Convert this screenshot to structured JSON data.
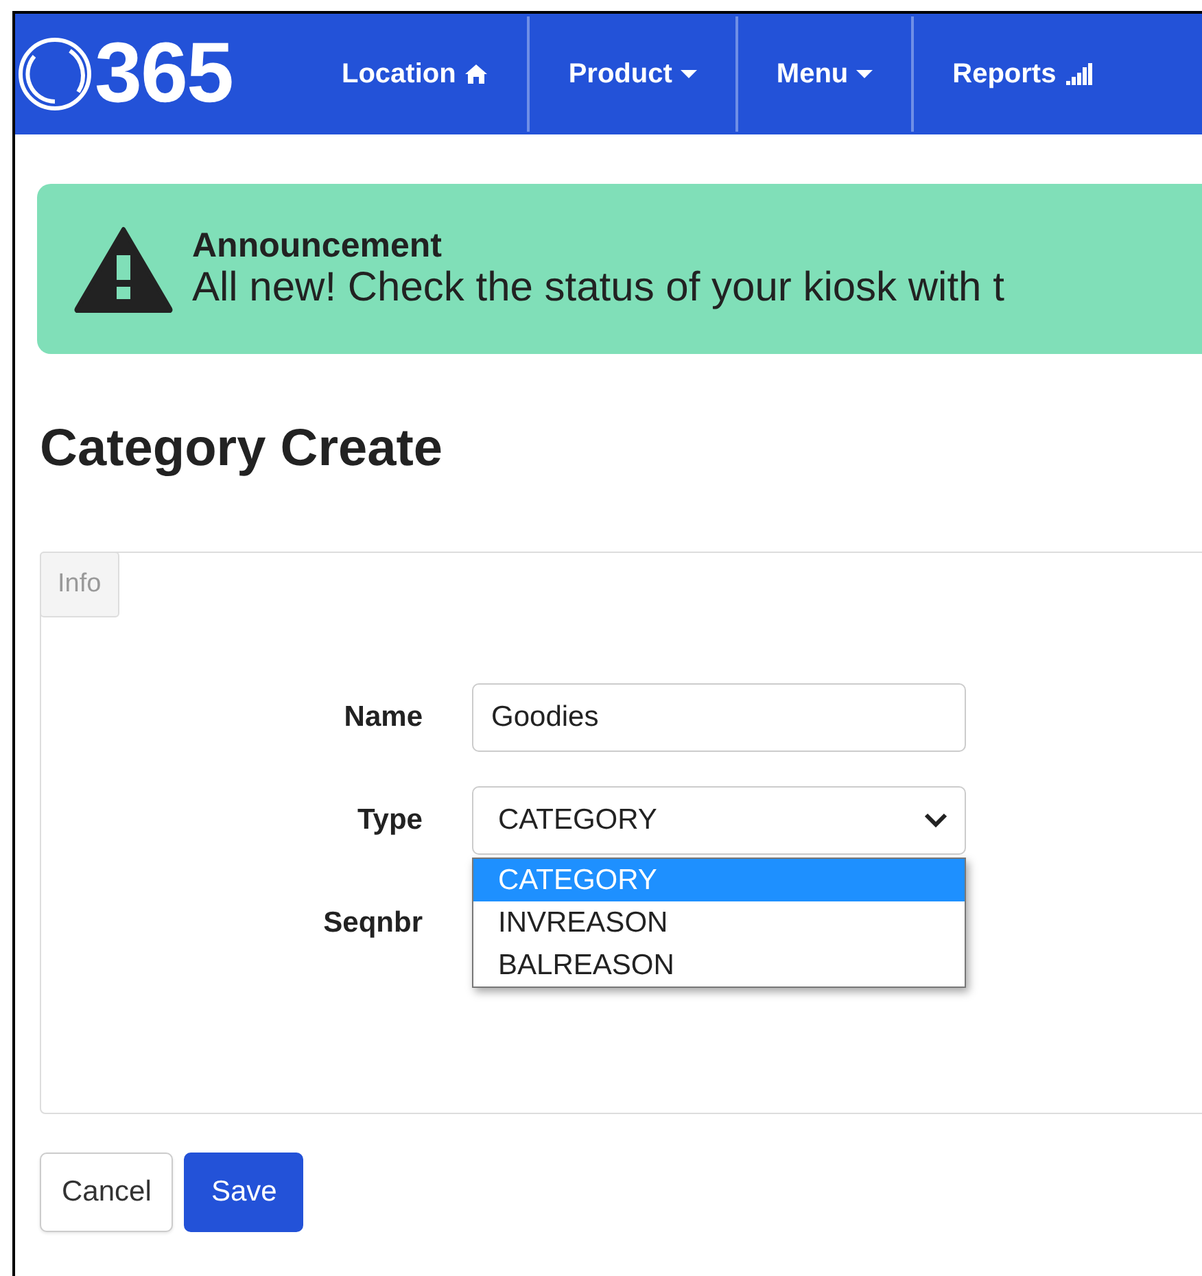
{
  "navbar": {
    "brand": "365",
    "items": [
      {
        "label": "Location",
        "kind": "home"
      },
      {
        "label": "Product",
        "kind": "dropdown"
      },
      {
        "label": "Menu",
        "kind": "dropdown"
      },
      {
        "label": "Reports",
        "kind": "signal"
      }
    ]
  },
  "announcement": {
    "title": "Announcement",
    "text": "All new! Check the status of your kiosk with t"
  },
  "heading": "Category Create",
  "tabs": [
    {
      "label": "Info",
      "selected": false
    }
  ],
  "form": {
    "fields": [
      {
        "label": "Name",
        "kind": "text",
        "value": "Goodies"
      },
      {
        "label": "Type",
        "kind": "select",
        "value": "CATEGORY",
        "expanded": true,
        "options": [
          {
            "label": "CATEGORY",
            "selected": true
          },
          {
            "label": "INVREASON",
            "selected": false
          },
          {
            "label": "BALREASON",
            "selected": false
          }
        ]
      },
      {
        "label": "Seqnbr",
        "kind": "hidden-input"
      }
    ]
  },
  "buttons": [
    {
      "label": "Cancel",
      "kind": "secondary"
    },
    {
      "label": "Save",
      "kind": "primary"
    }
  ]
}
